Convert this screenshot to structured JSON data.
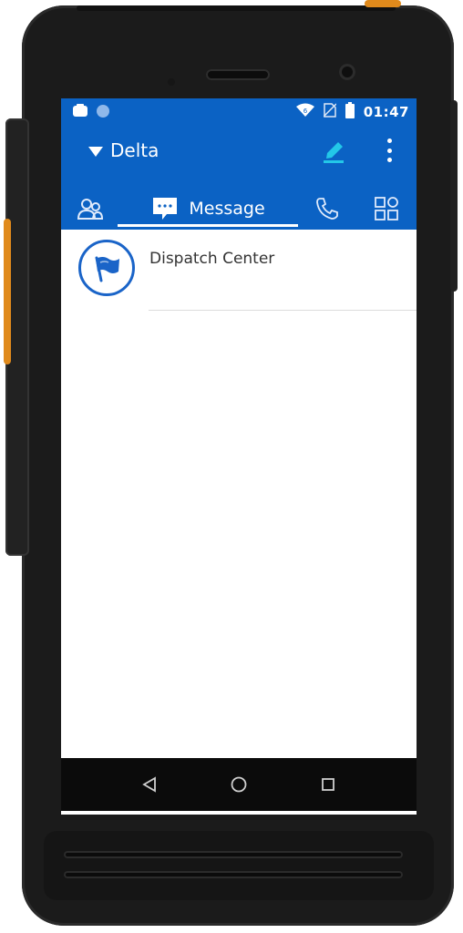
{
  "statusbar": {
    "time": "01:47",
    "icons": [
      "ptt-app-icon",
      "sync-icon",
      "wifi-icon",
      "no-sim-icon",
      "battery-icon"
    ]
  },
  "appbar": {
    "group_name": "Delta",
    "icons": [
      "dropdown-caret-icon",
      "edit-icon",
      "more-vert-icon"
    ]
  },
  "tabs": [
    {
      "id": "contacts",
      "icon": "contacts-icon",
      "label": ""
    },
    {
      "id": "message",
      "icon": "message-icon",
      "label": "Message",
      "selected": true
    },
    {
      "id": "calls",
      "icon": "phone-icon",
      "label": ""
    },
    {
      "id": "apps",
      "icon": "grid-icon",
      "label": ""
    }
  ],
  "conversations": [
    {
      "title": "Dispatch Center",
      "avatar_icon": "flag-icon"
    }
  ],
  "navbar": {
    "icons": [
      "back-icon",
      "home-icon",
      "recents-icon"
    ]
  },
  "colors": {
    "primary": "#0B62C4",
    "accent_cyan": "#23C7E8",
    "avatar_ring": "#1A64C8"
  }
}
